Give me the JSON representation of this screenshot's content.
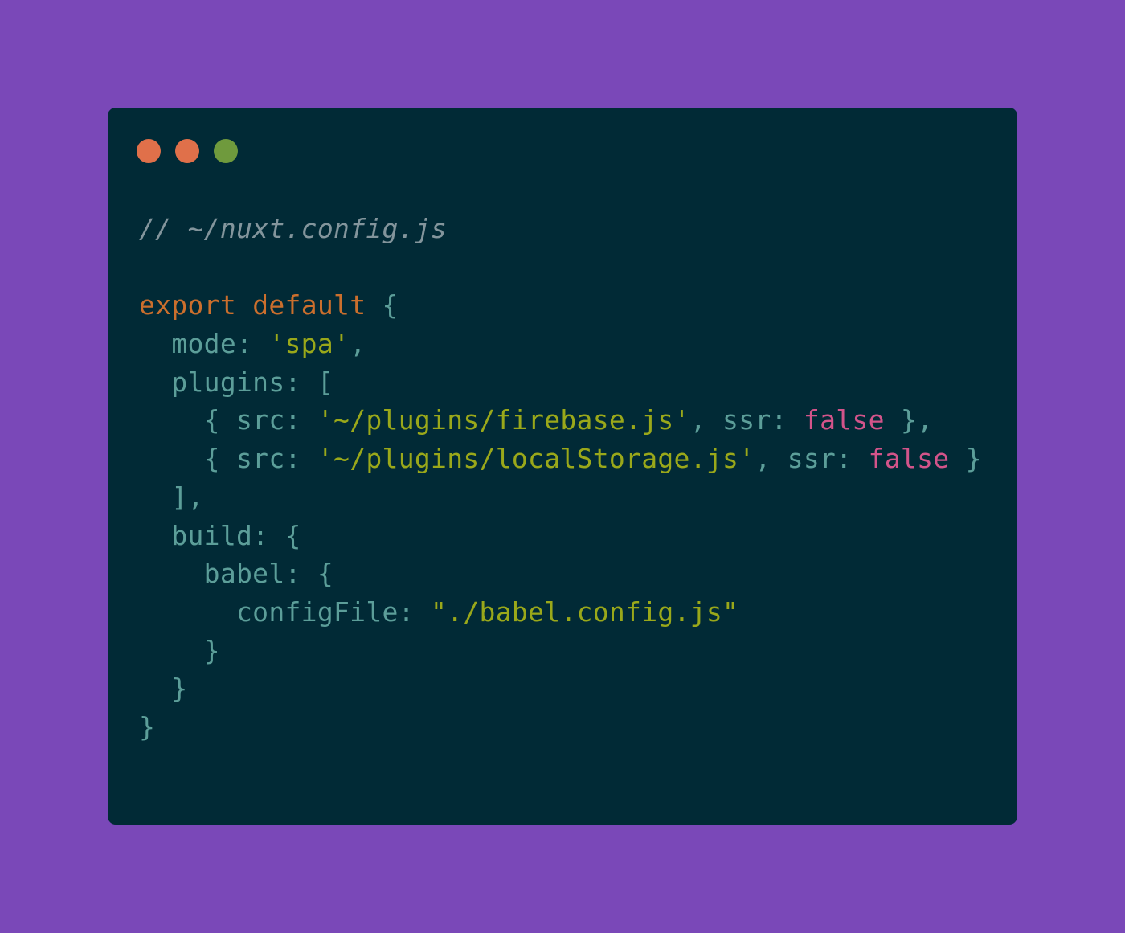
{
  "colors": {
    "background": "#7a48b8",
    "window": "#012a36",
    "close_dot": "#e0704a",
    "minimize_dot": "#e0704a",
    "maximize_dot": "#6f9a3d",
    "comment": "#83959c",
    "keyword": "#cb6f2d",
    "punctuation": "#5c9e99",
    "property": "#5c9e99",
    "string": "#9aa81a",
    "boolean": "#d3548a"
  },
  "window_controls": [
    "close-dot",
    "minimize-dot",
    "maximize-dot"
  ],
  "code_lines": [
    [
      {
        "t": "// ~/nuxt.config.js",
        "k": "comment"
      }
    ],
    [],
    [
      {
        "t": "export",
        "k": "keyword"
      },
      {
        "t": " ",
        "k": "punctuation"
      },
      {
        "t": "default",
        "k": "keyword"
      },
      {
        "t": " {",
        "k": "punctuation"
      }
    ],
    [
      {
        "t": "  mode: ",
        "k": "property"
      },
      {
        "t": "'spa'",
        "k": "string"
      },
      {
        "t": ",",
        "k": "punctuation"
      }
    ],
    [
      {
        "t": "  plugins: [",
        "k": "property"
      }
    ],
    [
      {
        "t": "    { src: ",
        "k": "property"
      },
      {
        "t": "'~/plugins/firebase.js'",
        "k": "string"
      },
      {
        "t": ", ssr: ",
        "k": "property"
      },
      {
        "t": "false",
        "k": "boolean"
      },
      {
        "t": " },",
        "k": "punctuation"
      }
    ],
    [
      {
        "t": "    { src: ",
        "k": "property"
      },
      {
        "t": "'~/plugins/localStorage.js'",
        "k": "string"
      },
      {
        "t": ", ssr: ",
        "k": "property"
      },
      {
        "t": "false",
        "k": "boolean"
      },
      {
        "t": " }",
        "k": "punctuation"
      }
    ],
    [
      {
        "t": "  ],",
        "k": "punctuation"
      }
    ],
    [
      {
        "t": "  build: {",
        "k": "property"
      }
    ],
    [
      {
        "t": "    babel: {",
        "k": "property"
      }
    ],
    [
      {
        "t": "      configFile: ",
        "k": "property"
      },
      {
        "t": "\"./babel.config.js\"",
        "k": "string"
      }
    ],
    [
      {
        "t": "    }",
        "k": "punctuation"
      }
    ],
    [
      {
        "t": "  }",
        "k": "punctuation"
      }
    ],
    [
      {
        "t": "}",
        "k": "punctuation"
      }
    ]
  ]
}
